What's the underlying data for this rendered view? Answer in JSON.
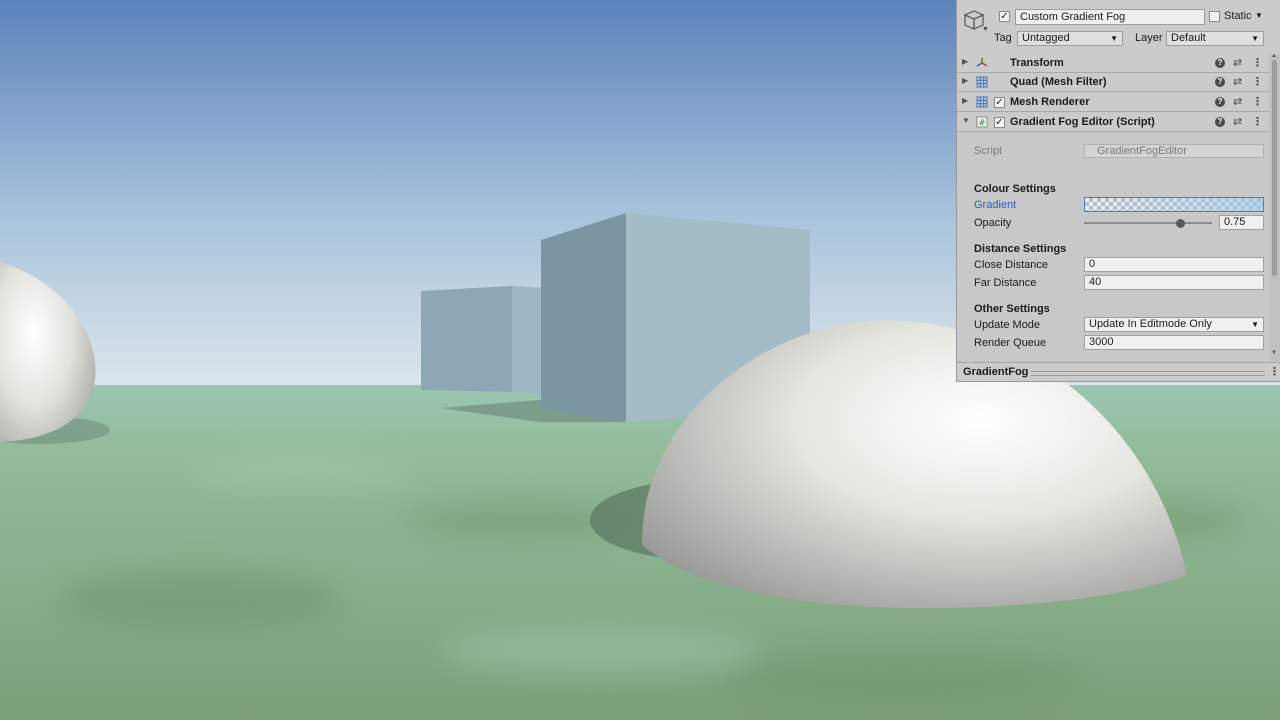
{
  "header": {
    "object_name": "Custom Gradient Fog",
    "active_checked": "✓",
    "static_label": "Static",
    "tag_label": "Tag",
    "tag_value": "Untagged",
    "layer_label": "Layer",
    "layer_value": "Default"
  },
  "components": [
    {
      "title": "Transform",
      "icon": "transform-icon"
    },
    {
      "title": "Quad (Mesh Filter)",
      "icon": "mesh-filter-icon"
    },
    {
      "title": "Mesh Renderer",
      "icon": "mesh-renderer-icon",
      "enabled": "✓"
    },
    {
      "title": "Gradient Fog Editor (Script)",
      "icon": "script-icon",
      "enabled": "✓"
    }
  ],
  "script": {
    "label": "Script",
    "value": "GradientFogEditor",
    "colour_settings": "Colour Settings",
    "gradient_label": "Gradient",
    "opacity_label": "Opacity",
    "opacity_value": "0.75",
    "opacity": 0.75,
    "distance_settings": "Distance Settings",
    "close_label": "Close Distance",
    "close_value": "0",
    "far_label": "Far Distance",
    "far_value": "40",
    "other_settings": "Other Settings",
    "update_mode_label": "Update Mode",
    "update_mode_value": "Update In Editmode Only",
    "render_queue_label": "Render Queue",
    "render_queue_value": "3000"
  },
  "footer": {
    "title": "GradientFog"
  },
  "colors": {
    "sky_top": "#5f86bd",
    "sky_horizon": "#d6e3ea",
    "ground": "#8fb595",
    "gradient_link": "#2b5fb3"
  }
}
